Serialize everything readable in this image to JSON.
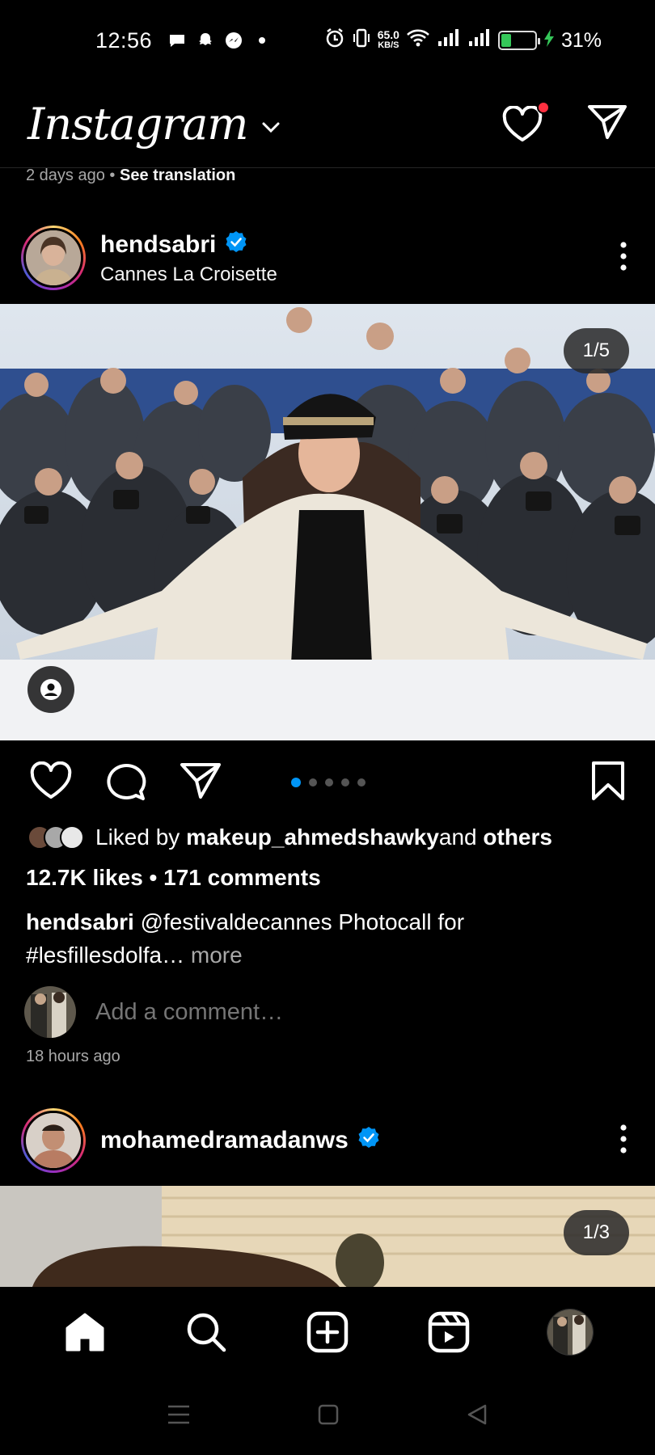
{
  "status_bar": {
    "time": "12:56",
    "net_speed_value": "65.0",
    "net_speed_unit": "KB/S",
    "battery_pct": "31%",
    "battery_level": 0.31
  },
  "header": {
    "logo": "Instagram"
  },
  "previous_post": {
    "time": "2 days ago",
    "separator": " • ",
    "see_translation": "See translation"
  },
  "post1": {
    "username": "hendsabri",
    "location": "Cannes La Croisette",
    "media_counter": "1/5",
    "carousel_total": 5,
    "carousel_active": 1,
    "liked_by_prefix": "Liked by ",
    "liked_by_user": "makeup_ahmedshawky",
    "liked_by_and": " and ",
    "liked_by_others": "others",
    "counts": "12.7K likes • 171 comments",
    "caption_user": "hendsabri",
    "caption_text": " @festivaldecannes Photocall for #lesfillesdolfa…",
    "caption_more": " more",
    "add_comment_placeholder": "Add a comment…",
    "time_ago": "18 hours ago"
  },
  "post2": {
    "username": "mohamedramadanws",
    "media_counter": "1/3"
  },
  "colors": {
    "background": "#000000",
    "accent_blue": "#0095f6",
    "verified_blue": "#0095f6",
    "notification_red": "#ff3040",
    "secondary_text": "#a8a8a8"
  },
  "icons": {
    "header": [
      "heart-icon",
      "direct-message-icon"
    ],
    "post_actions": [
      "heart-icon",
      "comment-icon",
      "share-icon",
      "bookmark-icon"
    ],
    "bottom_nav": [
      "home-icon",
      "search-icon",
      "create-icon",
      "reels-icon",
      "profile-avatar"
    ]
  }
}
